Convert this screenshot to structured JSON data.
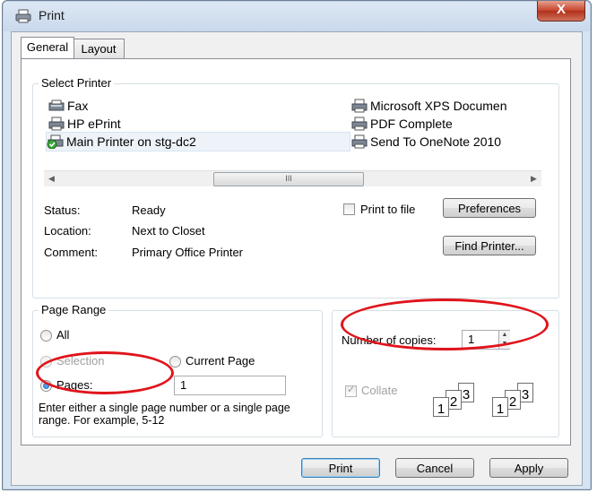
{
  "window": {
    "title": "Print",
    "close_glyph": "X"
  },
  "tabs": [
    {
      "label": "General",
      "active": true
    },
    {
      "label": "Layout",
      "active": false
    }
  ],
  "select_printer": {
    "label": "Select Printer",
    "printers": [
      {
        "name": "Fax",
        "icon": "fax-icon"
      },
      {
        "name": "HP ePrint",
        "icon": "printer-icon"
      },
      {
        "name": "Main Printer on stg-dc2",
        "icon": "network-printer-icon",
        "selected": true
      },
      {
        "name": "Microsoft XPS Documen",
        "icon": "printer-icon"
      },
      {
        "name": "PDF Complete",
        "icon": "printer-icon"
      },
      {
        "name": "Send To OneNote 2010",
        "icon": "printer-icon"
      }
    ],
    "scroll_thumb_glyph": "III"
  },
  "status": {
    "status_label": "Status:",
    "status_value": "Ready",
    "location_label": "Location:",
    "location_value": "Next to Closet",
    "comment_label": "Comment:",
    "comment_value": "Primary Office Printer"
  },
  "print_to_file": {
    "label": "Print to file",
    "checked": false
  },
  "buttons": {
    "preferences": "Preferences",
    "find_printer": "Find Printer...",
    "print": "Print",
    "cancel": "Cancel",
    "apply": "Apply"
  },
  "page_range": {
    "label": "Page Range",
    "all": "All",
    "selection": "Selection",
    "current_page": "Current Page",
    "pages": "Pages:",
    "pages_value": "1",
    "hint": "Enter either a single page number or a single page range.  For example, 5-12",
    "selected_option": "Pages"
  },
  "copies": {
    "label": "Number of copies:",
    "value": "1",
    "collate_label": "Collate",
    "collate_checked": true
  },
  "collate_pages": [
    "1",
    "2",
    "3"
  ],
  "colors": {
    "highlight": "#e0141b",
    "close_button": "#c7432b"
  }
}
